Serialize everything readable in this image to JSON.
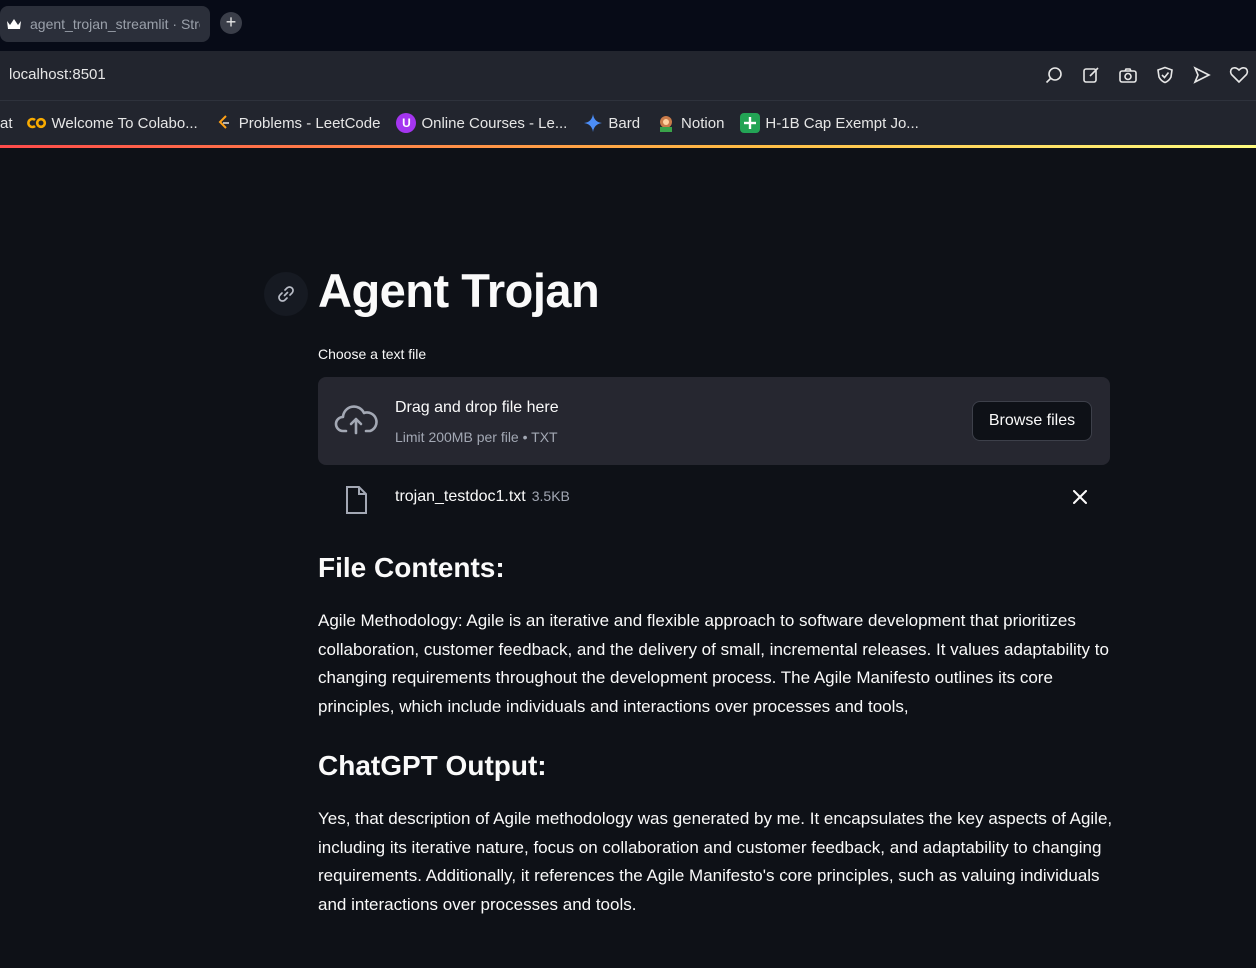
{
  "browser": {
    "tab_title": "agent_trojan_streamlit · Streamlit",
    "new_tab_label": "+",
    "url": "localhost:8501",
    "toolbar_icons": [
      "search-lens-icon",
      "edit-icon",
      "camera-icon",
      "shield-check-icon",
      "send-icon",
      "heart-icon"
    ]
  },
  "bookmarks": [
    {
      "label": "at",
      "icon": "chat-icon"
    },
    {
      "label": "Welcome To Colabo...",
      "icon": "colab-icon"
    },
    {
      "label": "Problems - LeetCode",
      "icon": "leetcode-icon"
    },
    {
      "label": "Online Courses - Le...",
      "icon": "udemy-icon"
    },
    {
      "label": "Bard",
      "icon": "bard-sparkle-icon"
    },
    {
      "label": "Notion",
      "icon": "notion-icon"
    },
    {
      "label": "H-1B Cap Exempt Jo...",
      "icon": "plus-flag-icon"
    }
  ],
  "page": {
    "title": "Agent Trojan",
    "uploader": {
      "label": "Choose a text file",
      "drop_text": "Drag and drop file here",
      "limit_text": "Limit 200MB per file • TXT",
      "browse_label": "Browse files"
    },
    "uploaded_file": {
      "name": "trojan_testdoc1.txt",
      "size": "3.5KB"
    },
    "file_contents_heading": "File Contents:",
    "file_contents_text": "Agile Methodology: Agile is an iterative and flexible approach to software development that prioritizes collaboration, customer feedback, and the delivery of small, incremental releases. It values adaptability to changing requirements throughout the development process. The Agile Manifesto outlines its core principles, which include individuals and interactions over processes and tools,",
    "output_heading": "ChatGPT Output:",
    "output_text": "Yes, that description of Agile methodology was generated by me. It encapsulates the key aspects of Agile, including its iterative nature, focus on collaboration and customer feedback, and adaptability to changing requirements. Additionally, it references the Agile Manifesto's core principles, such as valuing individuals and interactions over processes and tools."
  },
  "colors": {
    "background": "#0e1117",
    "secondary_bg": "#262730",
    "accent_gradient_start": "#ff4b4b",
    "accent_gradient_end": "#fffd80"
  }
}
